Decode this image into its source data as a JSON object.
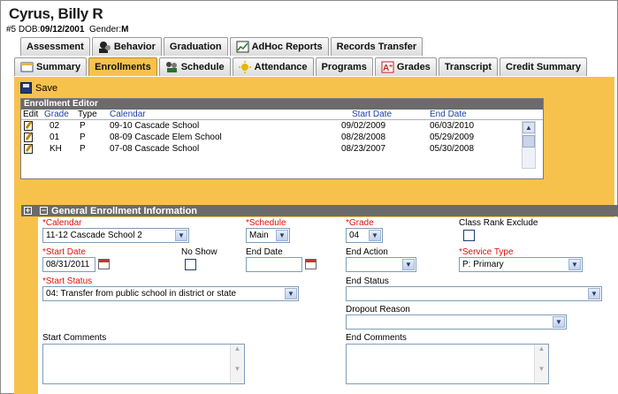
{
  "student": {
    "name": "Cyrus, Billy R",
    "id_prefix": "#5",
    "dob_label": "DOB:",
    "dob": "09/12/2001",
    "gender_label": "Gender:",
    "gender": "M"
  },
  "tabs_row1": [
    {
      "label": "Assessment",
      "icon": ""
    },
    {
      "label": "Behavior",
      "icon": "behavior-icon"
    },
    {
      "label": "Graduation",
      "icon": ""
    },
    {
      "label": "AdHoc Reports",
      "icon": "adhoc-icon"
    },
    {
      "label": "Records Transfer",
      "icon": ""
    }
  ],
  "tabs_row2": [
    {
      "label": "Summary",
      "icon": "summary-icon",
      "active": false
    },
    {
      "label": "Enrollments",
      "icon": "",
      "active": true
    },
    {
      "label": "Schedule",
      "icon": "schedule-icon",
      "active": false
    },
    {
      "label": "Attendance",
      "icon": "attendance-icon",
      "active": false
    },
    {
      "label": "Programs",
      "icon": "",
      "active": false
    },
    {
      "label": "Grades",
      "icon": "grades-icon",
      "active": false
    },
    {
      "label": "Transcript",
      "icon": "",
      "active": false
    },
    {
      "label": "Credit Summary",
      "icon": "",
      "active": false
    }
  ],
  "toolbar": {
    "save_label": "Save"
  },
  "editor": {
    "title": "Enrollment Editor",
    "columns": {
      "edit": "Edit",
      "grade": "Grade",
      "type": "Type",
      "calendar": "Calendar",
      "start": "Start Date",
      "end": "End Date"
    },
    "rows": [
      {
        "grade": "02",
        "type": "P",
        "calendar": "09-10 Cascade School",
        "start": "09/02/2009",
        "end": "06/03/2010"
      },
      {
        "grade": "01",
        "type": "P",
        "calendar": "08-09 Cascade Elem School",
        "start": "08/28/2008",
        "end": "05/29/2009"
      },
      {
        "grade": "KH",
        "type": "P",
        "calendar": "07-08 Cascade School",
        "start": "08/23/2007",
        "end": "05/30/2008"
      }
    ]
  },
  "general": {
    "title": "General Enrollment Information",
    "calendar_label": "*Calendar",
    "calendar_value": "11-12 Cascade School 2",
    "schedule_label": "*Schedule",
    "schedule_value": "Main",
    "grade_label": "*Grade",
    "grade_value": "04",
    "class_rank_label": "Class Rank Exclude",
    "start_date_label": "*Start Date",
    "start_date_value": "08/31/2011",
    "no_show_label": "No Show",
    "end_date_label": "End Date",
    "end_date_value": "",
    "end_action_label": "End Action",
    "end_action_value": "",
    "service_type_label": "*Service Type",
    "service_type_value": "P: Primary",
    "start_status_label": "*Start Status",
    "start_status_value": "04: Transfer from public school in district or state",
    "end_status_label": "End Status",
    "end_status_value": "",
    "dropout_reason_label": "Dropout Reason",
    "dropout_reason_value": "",
    "start_comments_label": "Start Comments",
    "end_comments_label": "End Comments"
  },
  "colors": {
    "accent": "#f7c24c",
    "header_gray": "#6b6b6b",
    "required": "#dd1111",
    "link_blue": "#1b3ea8"
  }
}
